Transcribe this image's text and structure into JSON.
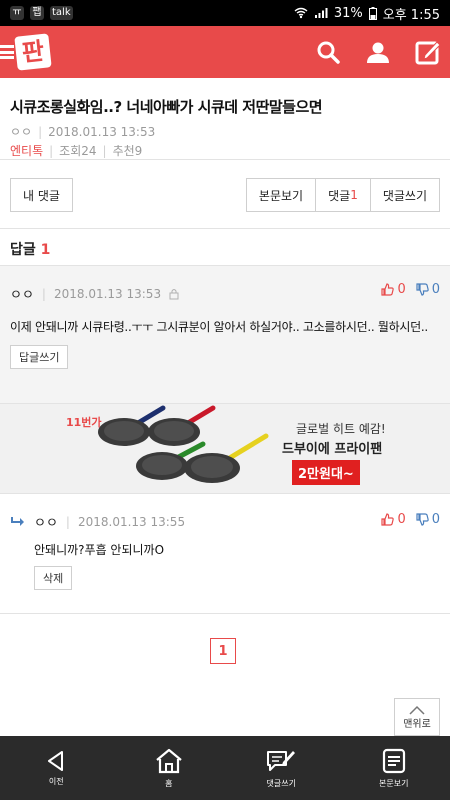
{
  "statusbar": {
    "notif_icons": [
      "ㅠ",
      "팹",
      "talk"
    ],
    "battery": "31%",
    "time_label": "오후 1:55"
  },
  "appbar": {
    "logo_text": "판",
    "icons": [
      "search-icon",
      "user-icon",
      "write-icon"
    ],
    "brand_color": "#e84a4a"
  },
  "post": {
    "title": "시큐조롱실화임..? 너네아빠가 시큐데 저딴말들으면",
    "author": "ㅇㅇ",
    "datetime": "2018.01.13 13:53",
    "category": "엔티톡",
    "views": "조회24",
    "recommend": "추천9"
  },
  "actions": {
    "my_comments": "내 댓글",
    "view_post": "본문보기",
    "comments_label": "댓글",
    "comments_count": "1",
    "write_comment": "댓글쓰기"
  },
  "replies": {
    "label": "답글",
    "count": "1"
  },
  "comment1": {
    "author": "ㅇㅇ",
    "datetime": "2018.01.13 13:53",
    "up_count": "0",
    "down_count": "0",
    "body": "이제 안돼니까 시큐타령..ㅜㅜ 그시큐분이 알아서 하실거야.. 고소를하시던.. 뭘하시던..",
    "reply_button": "답글쓰기"
  },
  "ad": {
    "badge": "11번가",
    "line1": "글로벌 히트 예감!",
    "line2": "드부이에 프라이팬",
    "price": "2만원대~"
  },
  "comment2": {
    "author": "ㅇㅇ",
    "datetime": "2018.01.13 13:55",
    "up_count": "0",
    "down_count": "0",
    "body": "안돼니까?푸흡 안되니까O",
    "delete_button": "삭제"
  },
  "pager": {
    "current": "1"
  },
  "totop": {
    "label": "맨위로"
  },
  "bottomnav": {
    "back": "이전",
    "home": "홈",
    "write_comment": "댓글쓰기",
    "view_post": "본문보기"
  }
}
